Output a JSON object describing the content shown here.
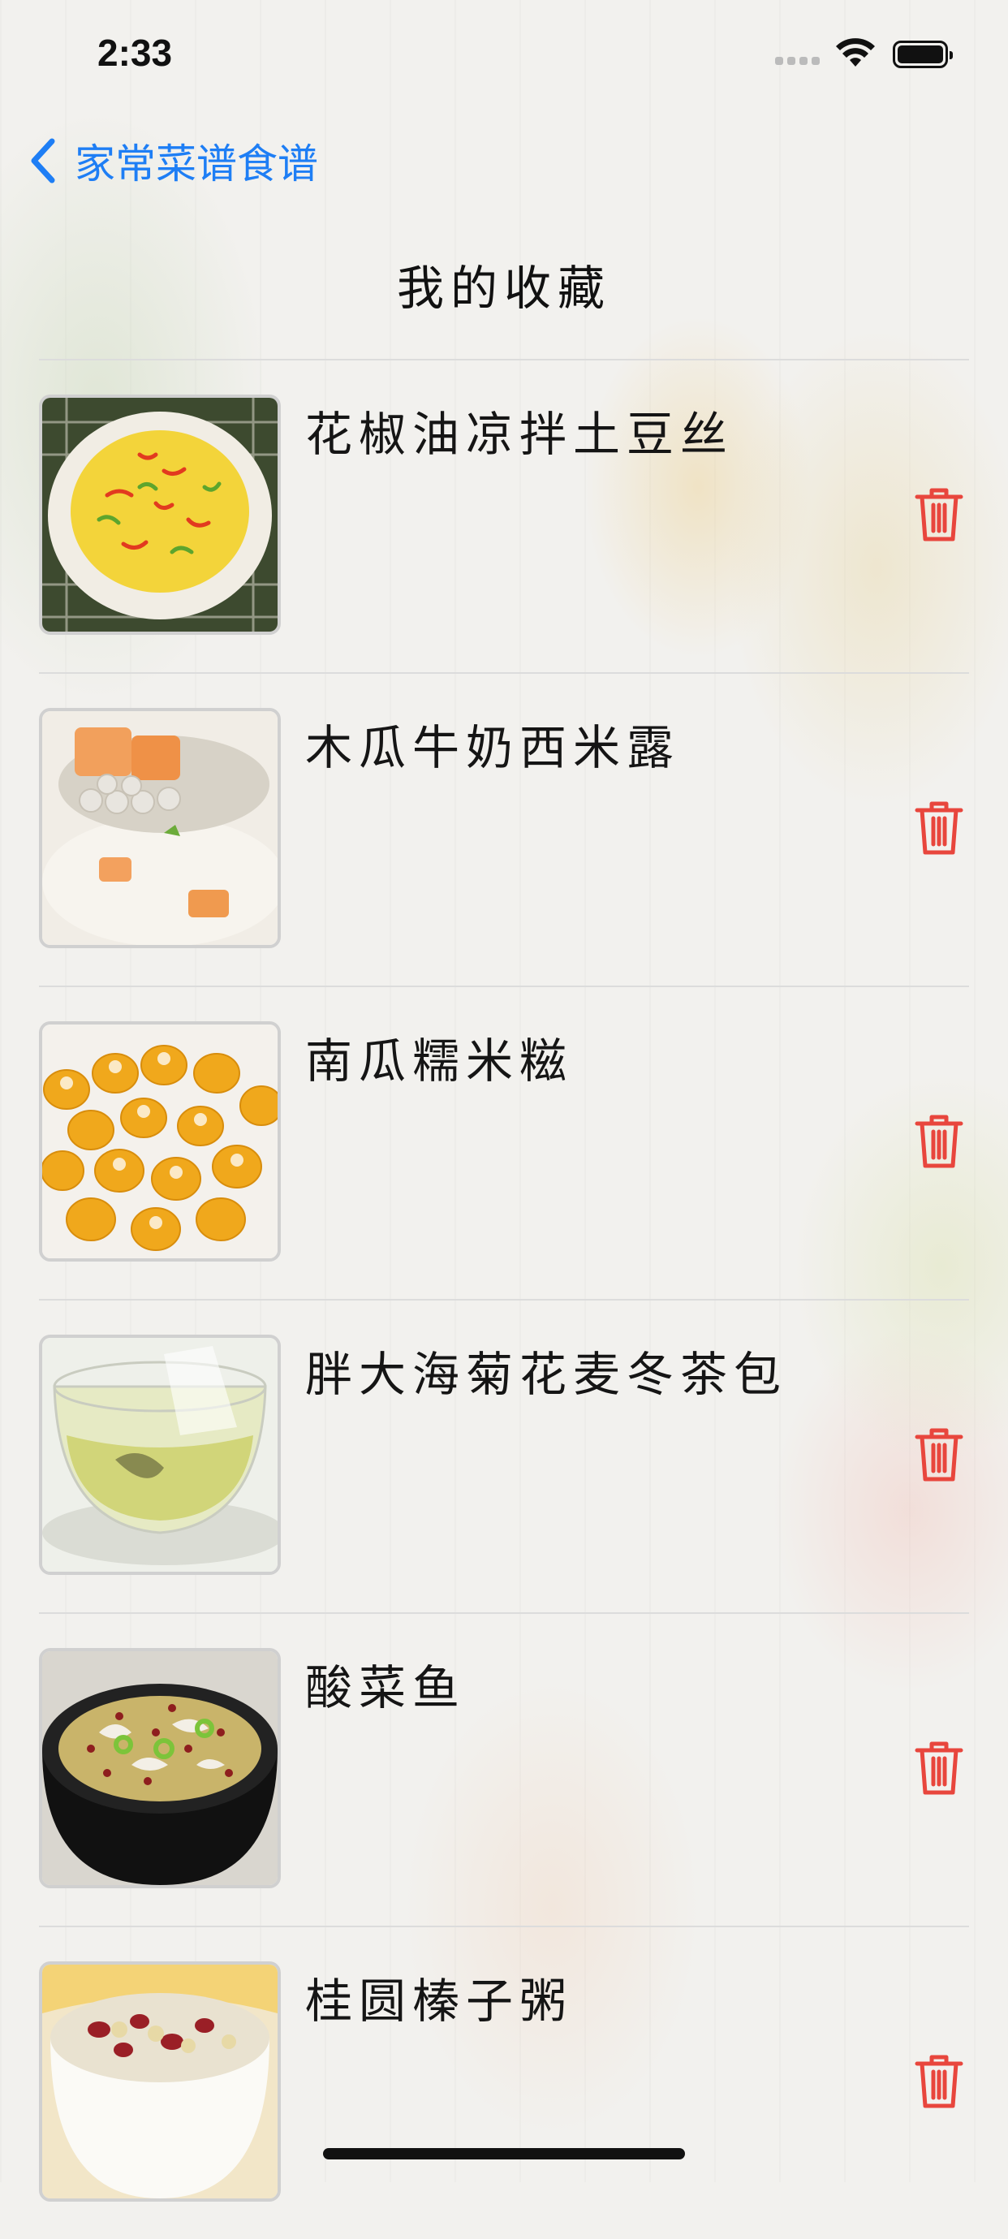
{
  "status_bar": {
    "time": "2:33"
  },
  "nav": {
    "back_label": "家常菜谱食谱"
  },
  "page": {
    "title": "我的收藏"
  },
  "favorites": [
    {
      "name": "花椒油凉拌土豆丝"
    },
    {
      "name": "木瓜牛奶西米露"
    },
    {
      "name": "南瓜糯米糍"
    },
    {
      "name": "胖大海菊花麦冬茶包"
    },
    {
      "name": "酸菜鱼"
    },
    {
      "name": "桂圆榛子粥"
    }
  ],
  "colors": {
    "accent": "#1e7ef5",
    "delete": "#e8463d"
  },
  "icons": {
    "back": "chevron-left-icon",
    "delete": "trash-icon"
  }
}
